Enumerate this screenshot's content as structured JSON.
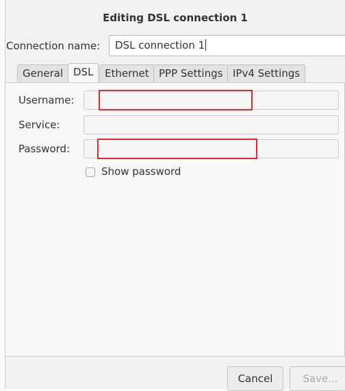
{
  "window": {
    "title": "Editing DSL connection 1"
  },
  "connection": {
    "label": "Connection name:",
    "value": "DSL connection 1"
  },
  "tabs": [
    {
      "label": "General"
    },
    {
      "label": "DSL"
    },
    {
      "label": "Ethernet"
    },
    {
      "label": "PPP Settings"
    },
    {
      "label": "IPv4 Settings"
    }
  ],
  "active_tab": "DSL",
  "dsl": {
    "username_label": "Username:",
    "username_value": "",
    "service_label": "Service:",
    "service_value": "",
    "password_label": "Password:",
    "password_value": "",
    "show_password_label": "Show password",
    "show_password_checked": false
  },
  "buttons": {
    "cancel": "Cancel",
    "save": "Save..."
  },
  "colors": {
    "highlight": "#e8262b"
  }
}
